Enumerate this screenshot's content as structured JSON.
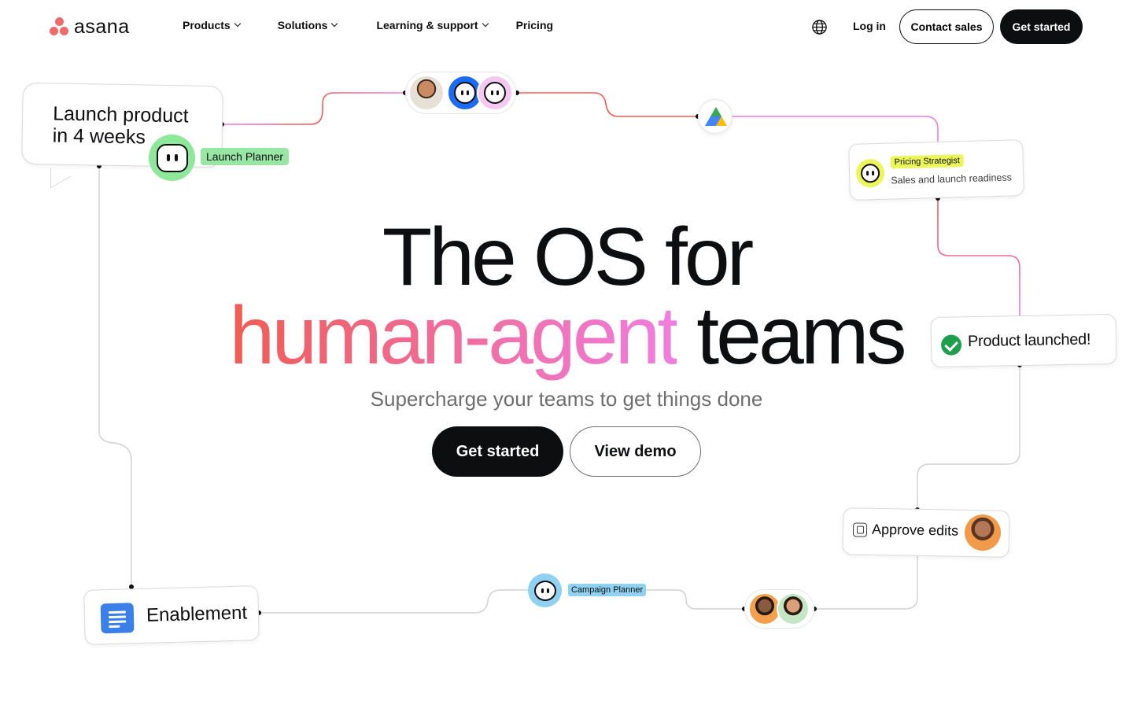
{
  "nav": {
    "logo_text": "asana",
    "items": [
      {
        "label": "Products",
        "has_dropdown": true
      },
      {
        "label": "Solutions",
        "has_dropdown": true
      },
      {
        "label": "Learning & support",
        "has_dropdown": true
      },
      {
        "label": "Pricing",
        "has_dropdown": false
      }
    ],
    "language_icon": "globe-icon",
    "login": "Log in",
    "contact": "Contact sales",
    "get_started": "Get started"
  },
  "hero": {
    "line1": "The OS for",
    "line2_gradient": "human-agent",
    "line2_dark": "teams",
    "subtitle": "Supercharge your teams to get things done",
    "cta_primary": "Get started",
    "cta_secondary": "View demo"
  },
  "cards": {
    "launch": {
      "line1": "Launch product",
      "line2": "in 4 weeks",
      "agent_label": "Launch Planner"
    },
    "pricing": {
      "agent_label": "Pricing Strategist",
      "description": "Sales and launch readiness"
    },
    "launched": {
      "text": "Product launched!"
    },
    "approve": {
      "text": "Approve edits"
    },
    "campaign": {
      "agent_label": "Campaign Planner"
    },
    "enablement": {
      "text": "Enablement"
    }
  },
  "colors": {
    "brand_coral": "#f06a6a",
    "dark": "#0d0e10",
    "gradient_start": "#f15b51",
    "gradient_end": "#f07de0",
    "agent_green": "#8ee89a",
    "agent_yellow": "#ecf55a",
    "agent_blue": "#8ed1f0",
    "success_green": "#1f9e4e"
  }
}
